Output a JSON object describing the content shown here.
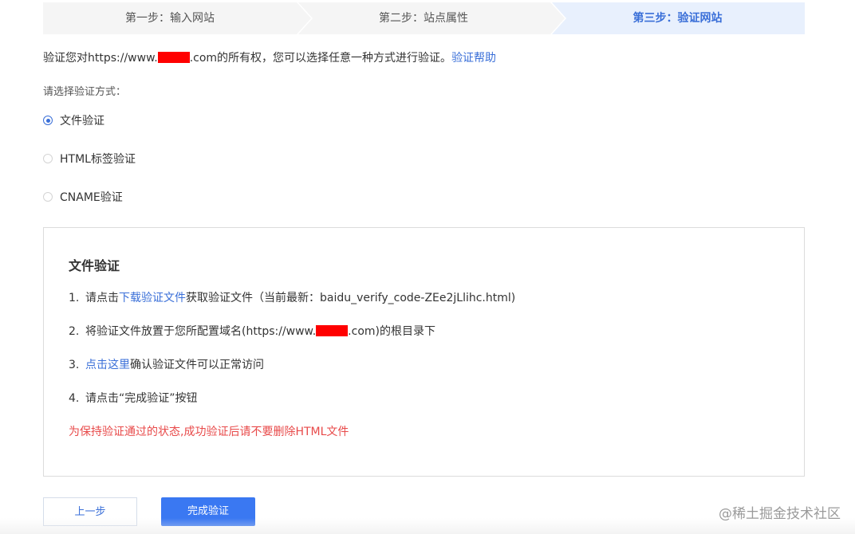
{
  "steps": {
    "step1": "第一步：输入网站",
    "step2": "第二步：站点属性",
    "step3": "第三步：验证网站"
  },
  "intro": {
    "prefix": "验证您对https://www.",
    "suffix": ".com的所有权，您可以选择任意一种方式进行验证。",
    "help_link": "验证帮助"
  },
  "choose_label": "请选择验证方式：",
  "methods": [
    {
      "label": "文件验证",
      "selected": true
    },
    {
      "label": "HTML标签验证",
      "selected": false
    },
    {
      "label": "CNAME验证",
      "selected": false
    }
  ],
  "panel": {
    "title": "文件验证",
    "step1": {
      "num": "1.",
      "pre": "请点击",
      "link": "下载验证文件",
      "post": "获取验证文件（当前最新：baidu_verify_code-ZEe2jLlihc.html)"
    },
    "step2": {
      "num": "2.",
      "pre": "将验证文件放置于您所配置域名(https://www.",
      "post": ".com)的根目录下"
    },
    "step3": {
      "num": "3.",
      "link": "点击这里",
      "post": "确认验证文件可以正常访问"
    },
    "step4": {
      "num": "4.",
      "text": "请点击“完成验证”按钮"
    },
    "warning": "为保持验证通过的状态,成功验证后请不要删除HTML文件"
  },
  "buttons": {
    "prev": "上一步",
    "done": "完成验证"
  },
  "watermark": "@稀土掘金技术社区",
  "colors": {
    "accent": "#3a6fd8",
    "primary_button": "#3a78f2",
    "warning": "#e84a4a",
    "step_active_bg": "#e8f0fd",
    "step_bg": "#f5f5f5"
  }
}
